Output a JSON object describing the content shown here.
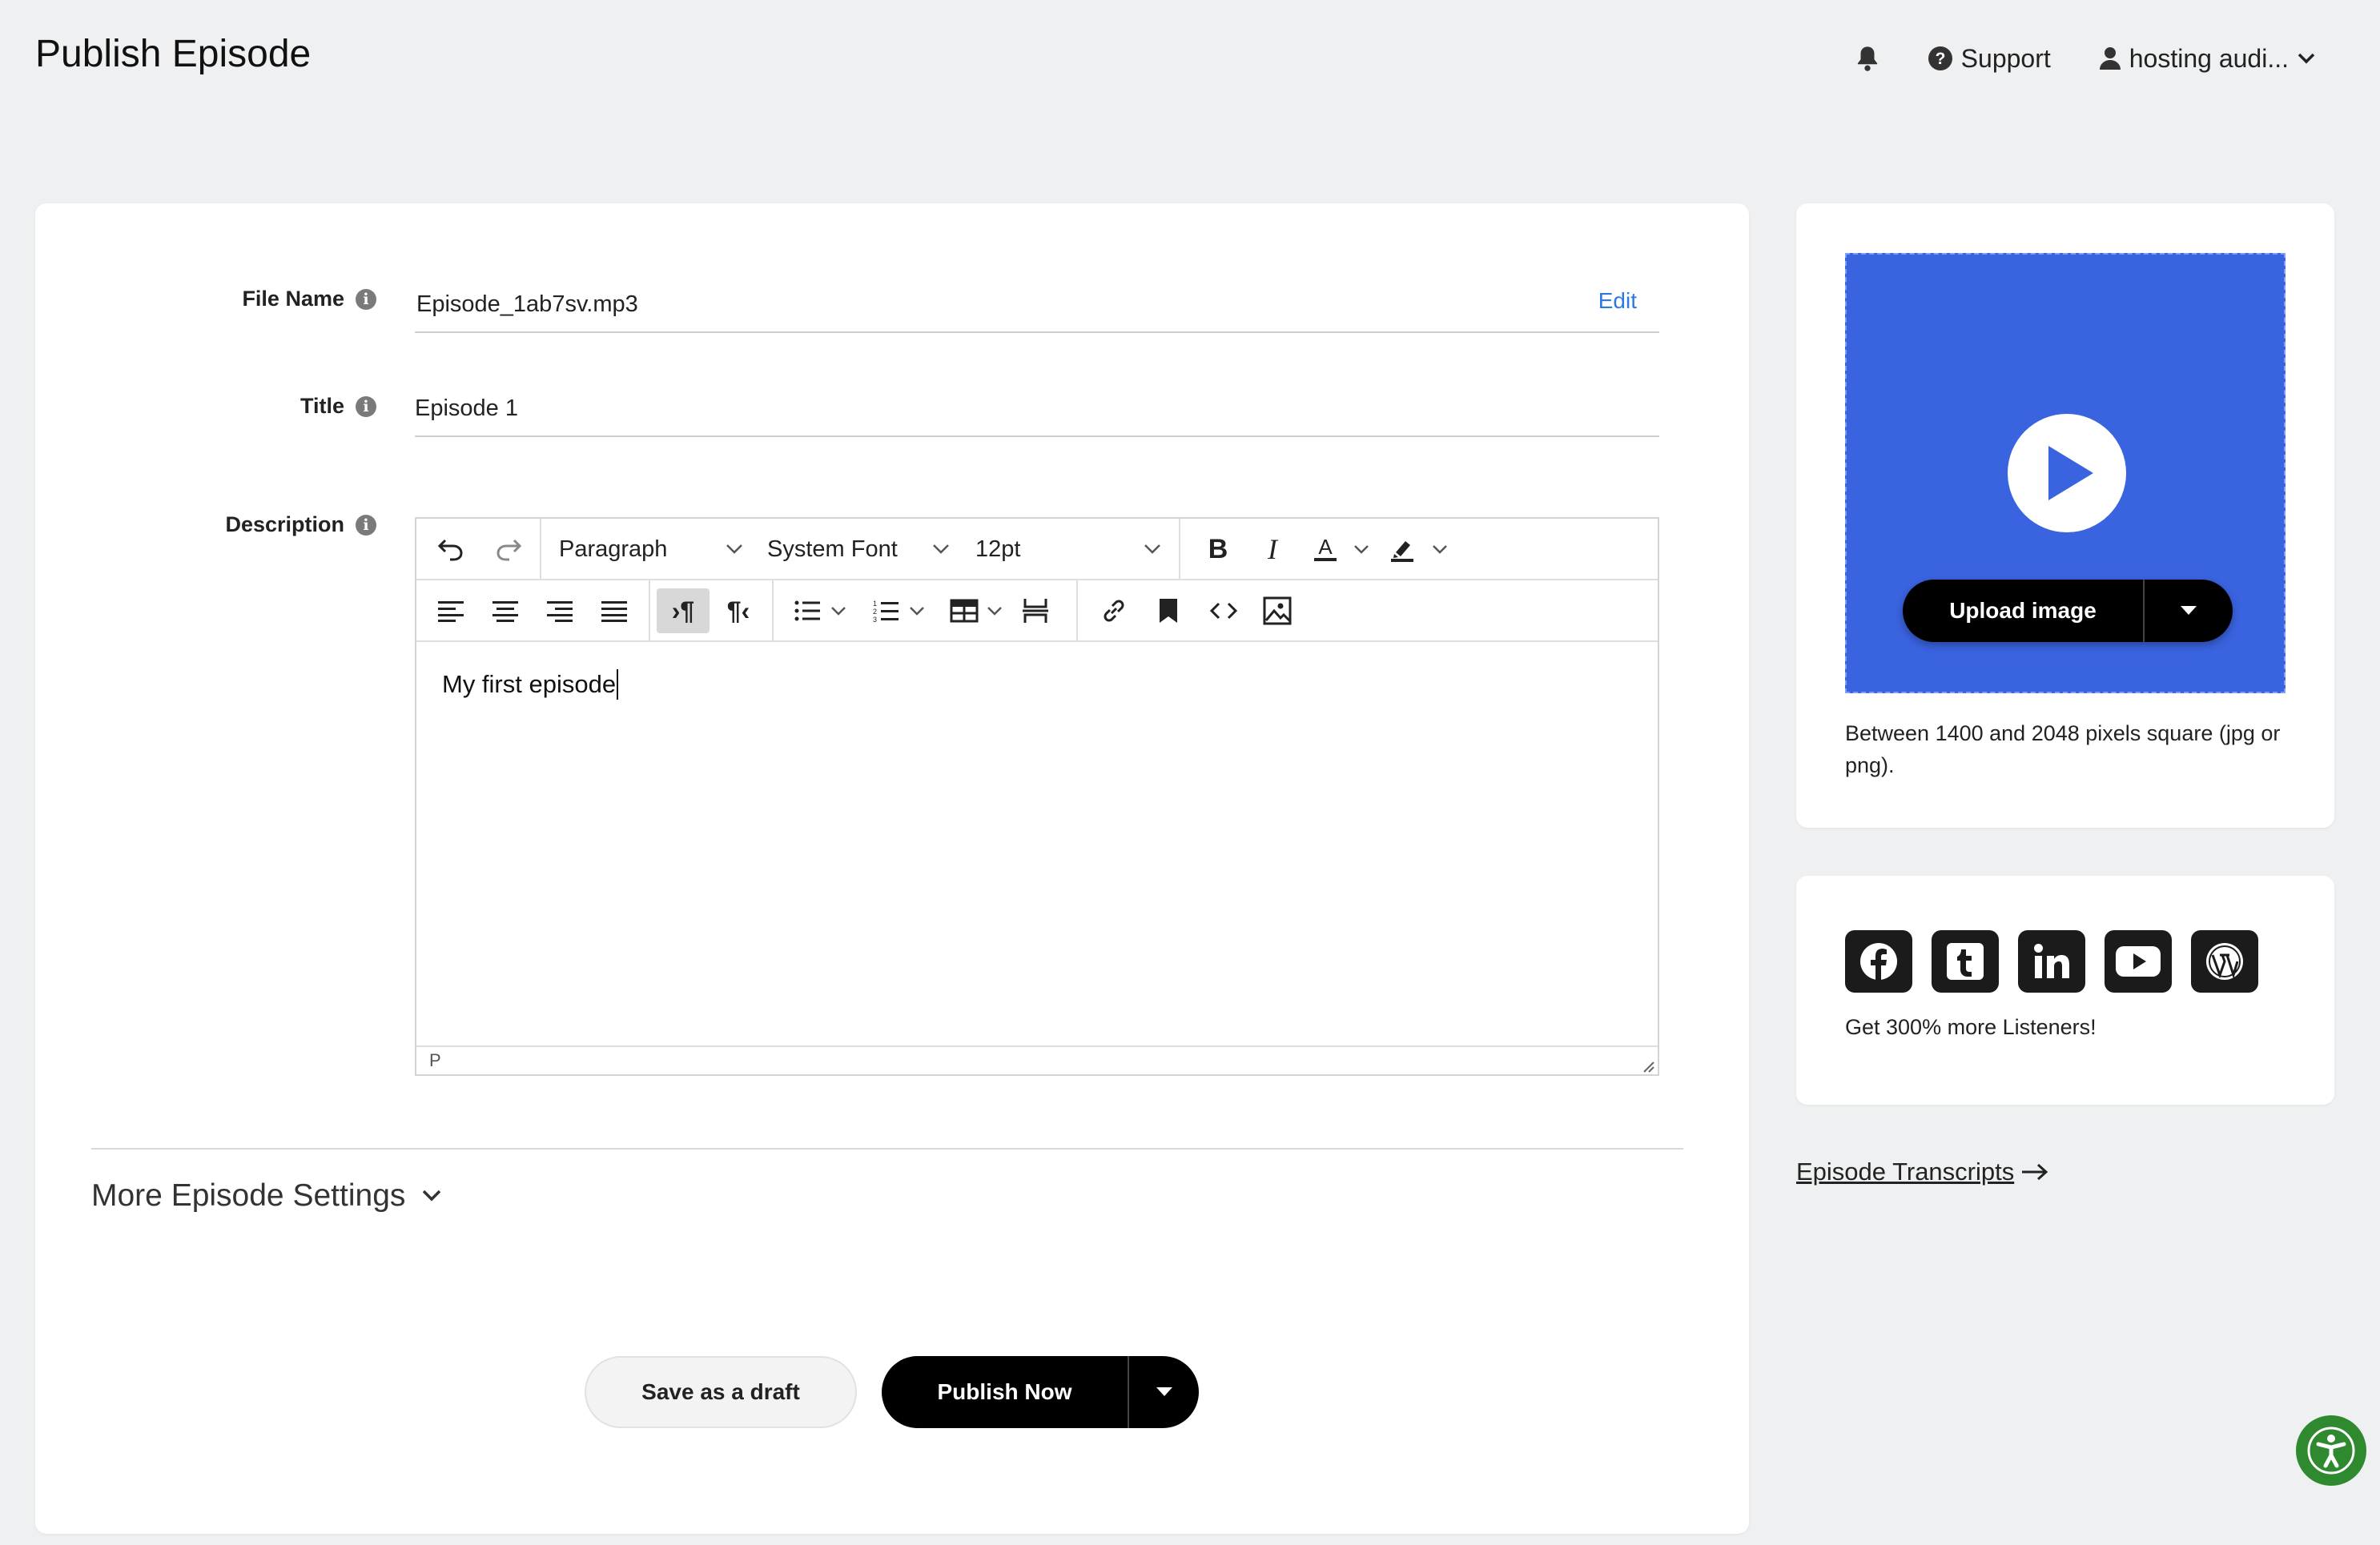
{
  "page": {
    "title": "Publish Episode"
  },
  "topnav": {
    "support": "Support",
    "account": "hosting audi..."
  },
  "form": {
    "file_name": {
      "label": "File Name",
      "value": "Episode_1ab7sv.mp3",
      "edit": "Edit"
    },
    "title": {
      "label": "Title",
      "value": "Episode 1"
    },
    "description": {
      "label": "Description",
      "content": "My first episode",
      "status_path": "P"
    }
  },
  "editor_toolbar": {
    "block_format": "Paragraph",
    "font_family": "System Font",
    "font_size": "12pt"
  },
  "more_settings": {
    "label": "More Episode Settings"
  },
  "actions": {
    "save_draft": "Save as a draft",
    "publish": "Publish Now"
  },
  "artwork": {
    "upload_label": "Upload image",
    "hint": "Between 1400 and 2048 pixels square (jpg or png).",
    "background_color": "#3a63e0"
  },
  "social": {
    "icons": [
      "facebook-icon",
      "tumblr-icon",
      "linkedin-icon",
      "youtube-icon",
      "wordpress-icon"
    ],
    "text": "Get 300% more Listeners!"
  },
  "transcripts": {
    "link": "Episode Transcripts"
  },
  "colors": {
    "accent": "#2a7ae2",
    "accessibility": "#2f8a2f",
    "dark": "#000000"
  }
}
